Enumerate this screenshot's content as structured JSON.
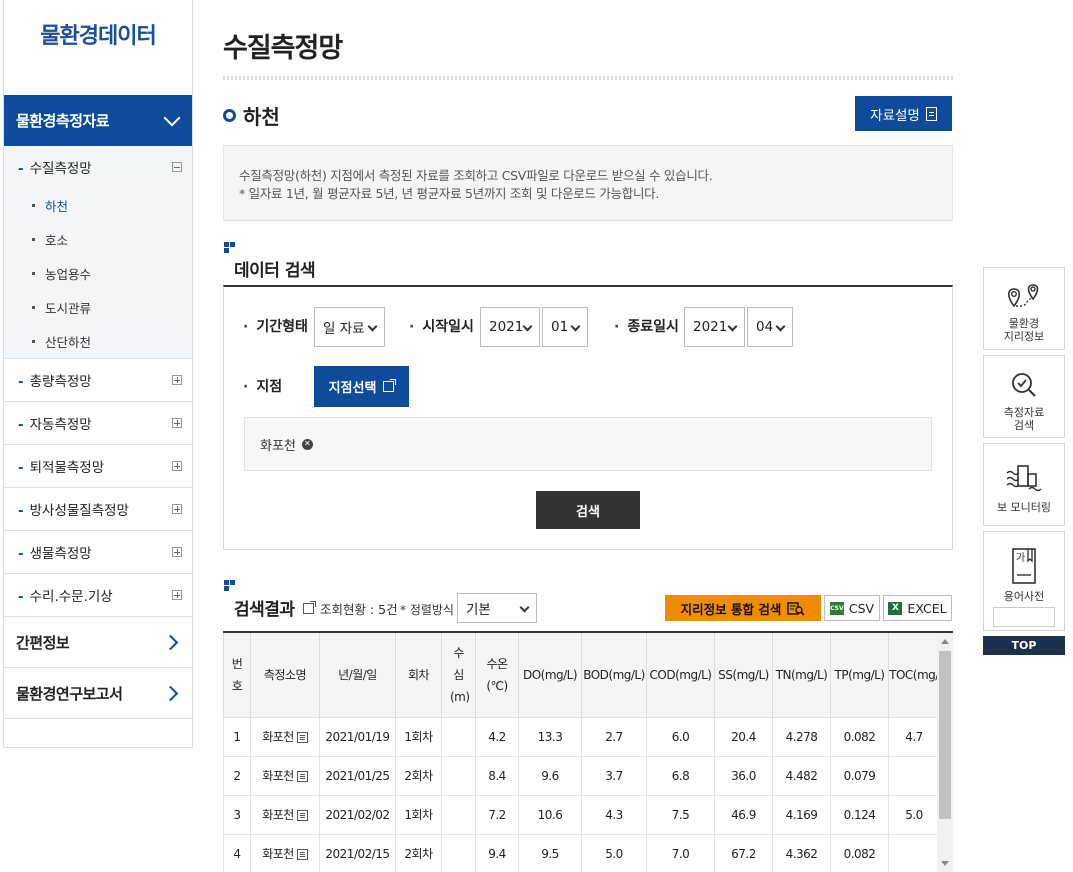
{
  "sidebar": {
    "logo": "물환경데이터",
    "main_menu": "물환경측정자료",
    "open_sub": {
      "label": "수질측정망",
      "items": [
        "하천",
        "호소",
        "농업용수",
        "도시관류",
        "산단하천"
      ]
    },
    "closed_subs": [
      "총량측정망",
      "자동측정망",
      "퇴적물측정망",
      "방사성물질측정망",
      "생물측정망",
      "수리.수문.기상"
    ],
    "top_menus": [
      "간편정보",
      "물환경연구보고서"
    ]
  },
  "page": {
    "title": "수질측정망",
    "section": "하천",
    "desc_button": "자료설명",
    "info_lines": [
      "수질측정망(하천) 지점에서 측정된 자료를 조회하고 CSV파일로 다운로드 받으실 수 있습니다.",
      "* 일자료 1년, 월 평균자료 5년, 년 평균자료 5년까지 조회 및 다운로드 가능합니다."
    ]
  },
  "search": {
    "heading": "데이터 검색",
    "period_type_label": "기간형태",
    "period_type_value": "일 자료",
    "start_label": "시작일시",
    "start_year": "2021",
    "start_month": "01",
    "end_label": "종료일시",
    "end_year": "2021",
    "end_month": "04",
    "site_label": "지점",
    "site_button": "지점선택",
    "selected_site": "화포천",
    "search_button": "검색"
  },
  "results": {
    "heading": "검색결과",
    "count_text": "조회현황 : 5건",
    "sort_label": "* 정렬방식",
    "sort_value": "기본",
    "geo_button": "지리정보 통합 검색",
    "csv_button": "CSV",
    "excel_button": "EXCEL",
    "columns": [
      "번호",
      "측정소명",
      "년/월/일",
      "회차",
      "수심(m)",
      "수온(℃)",
      "DO(mg/L)",
      "BOD(mg/L)",
      "COD(mg/L)",
      "SS(mg/L)",
      "TN(mg/L)",
      "TP(mg/L)",
      "TOC(mg/"
    ],
    "rows": [
      [
        "1",
        "화포천",
        "2021/01/19",
        "1회차",
        "",
        "4.2",
        "13.3",
        "2.7",
        "6.0",
        "20.4",
        "4.278",
        "0.082",
        "4.7"
      ],
      [
        "2",
        "화포천",
        "2021/01/25",
        "2회차",
        "",
        "8.4",
        "9.6",
        "3.7",
        "6.8",
        "36.0",
        "4.482",
        "0.079",
        ""
      ],
      [
        "3",
        "화포천",
        "2021/02/02",
        "1회차",
        "",
        "7.2",
        "10.6",
        "4.3",
        "7.5",
        "46.9",
        "4.169",
        "0.124",
        "5.0"
      ],
      [
        "4",
        "화포천",
        "2021/02/15",
        "2회차",
        "",
        "9.4",
        "9.5",
        "5.0",
        "7.0",
        "67.2",
        "4.362",
        "0.082",
        ""
      ]
    ]
  },
  "quick_menu": {
    "geo_info": "물환경\n지리정보",
    "data_search": "측정자료\n검색",
    "weir_monitoring": "보 모니터링",
    "glossary": "용어사전",
    "top": "TOP"
  },
  "colors": {
    "primary": "#0e4b9b",
    "accent": "#f08c00",
    "dark": "#333333"
  }
}
